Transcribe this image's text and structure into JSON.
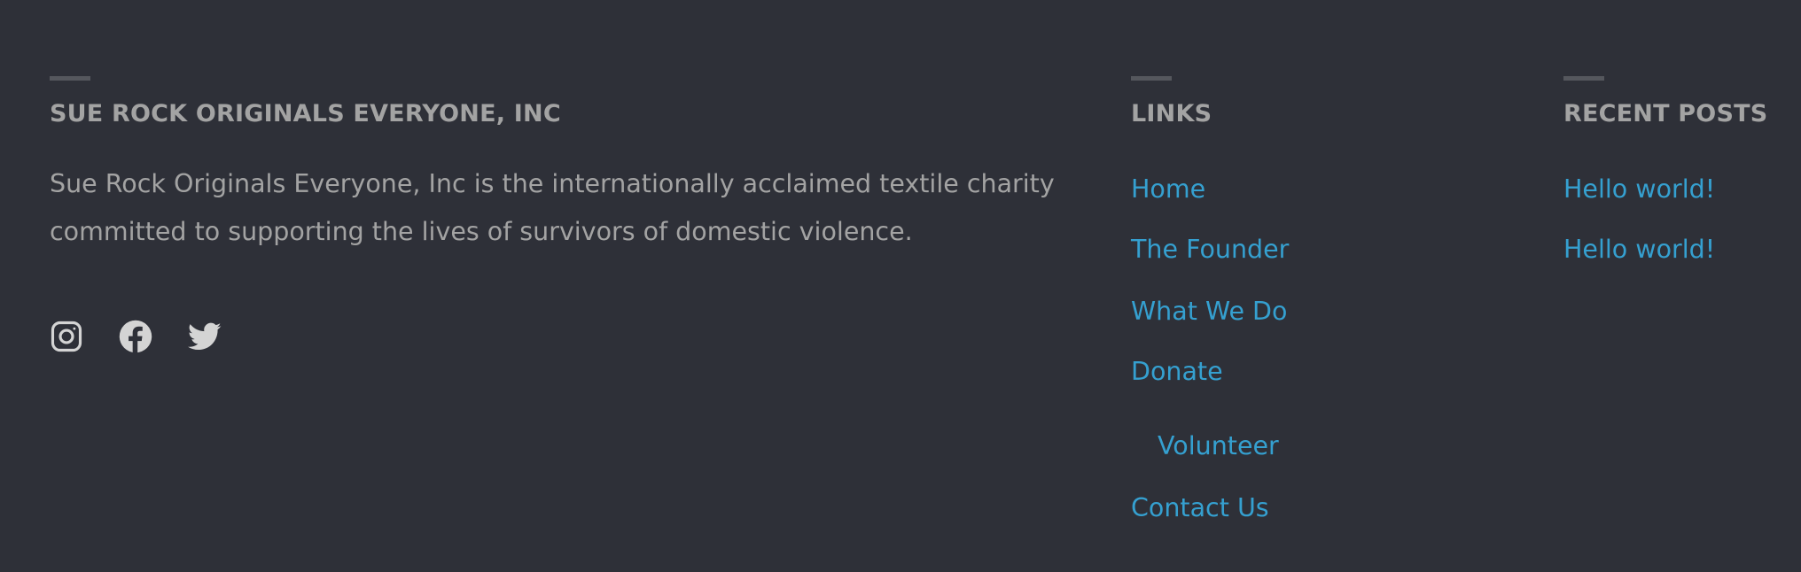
{
  "about": {
    "heading": "SUE ROCK ORIGINALS EVERYONE, INC",
    "description": "Sue Rock Originals Everyone, Inc is the internationally acclaimed textile charity committed to supporting the lives of survivors of domestic violence.",
    "social": [
      {
        "icon": "instagram-icon",
        "label": "Instagram"
      },
      {
        "icon": "facebook-icon",
        "label": "Facebook"
      },
      {
        "icon": "twitter-icon",
        "label": "Twitter"
      }
    ]
  },
  "links": {
    "heading": "LINKS",
    "items": [
      {
        "label": "Home",
        "level": 0
      },
      {
        "label": "The Founder",
        "level": 0
      },
      {
        "label": "What We Do",
        "level": 0
      },
      {
        "label": "Donate",
        "level": 0
      },
      {
        "label": "Volunteer",
        "level": 1
      },
      {
        "label": "Contact Us",
        "level": 0
      }
    ]
  },
  "recent_posts": {
    "heading": "RECENT POSTS",
    "items": [
      {
        "label": "Hello world!"
      },
      {
        "label": "Hello world!"
      }
    ]
  },
  "colors": {
    "background": "#2e3038",
    "heading_text": "#a3a3a3",
    "body_text": "#a3a3a3",
    "link": "#35a0d0",
    "icon": "#d4d4d4",
    "rule": "#55575d"
  }
}
